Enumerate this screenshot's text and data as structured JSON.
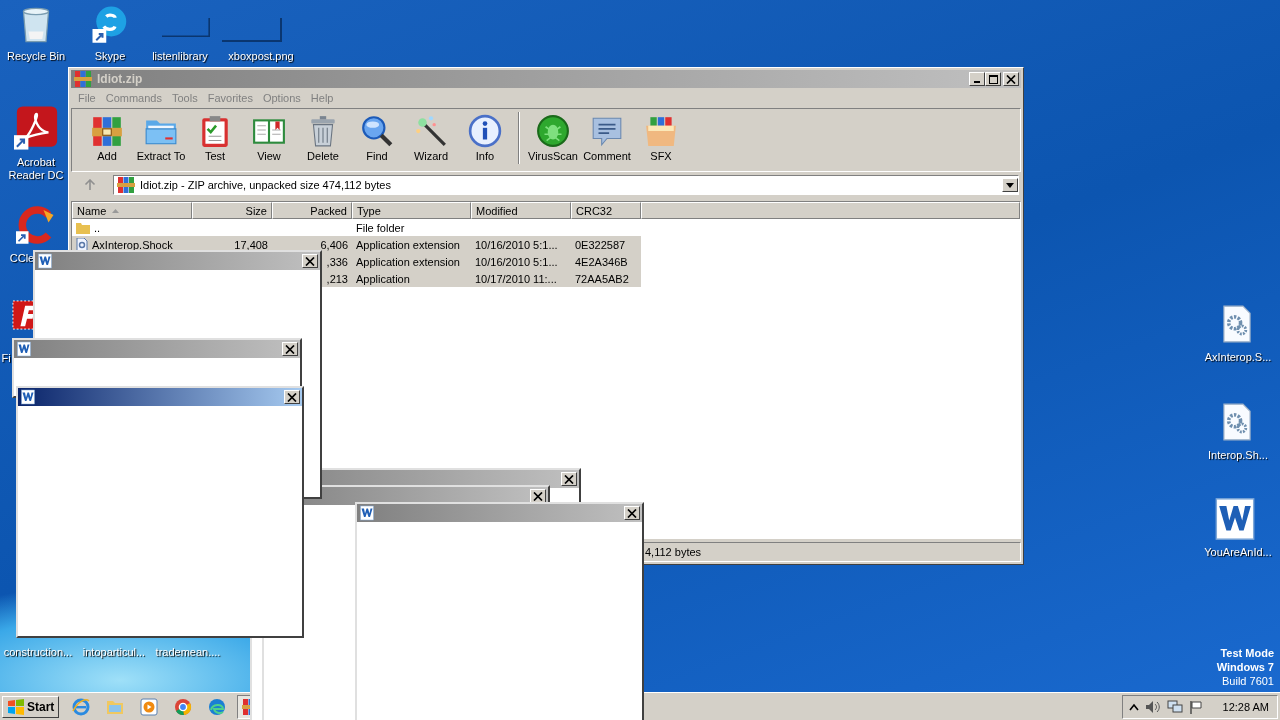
{
  "desktop_icons": [
    {
      "label": "Recycle Bin",
      "kind": "recycle"
    },
    {
      "label": "Skype",
      "kind": "skype"
    },
    {
      "label": "listenlibrary",
      "kind": "thumb"
    },
    {
      "label": "xboxpost.png",
      "kind": "thumb"
    },
    {
      "label": "Acrobat Reader DC",
      "kind": "acrobat"
    },
    {
      "label": "CCle",
      "kind": "ccleaner"
    },
    {
      "label": "Fi",
      "kind": "redapp"
    },
    {
      "label": "AxInterop.S...",
      "kind": "dll"
    },
    {
      "label": "Interop.Sh...",
      "kind": "dll"
    },
    {
      "label": "YouAreAnId...",
      "kind": "word"
    },
    {
      "label": "construction..."
    },
    {
      "label": "intoparticul..."
    },
    {
      "label": "trademean...."
    }
  ],
  "os_notice": {
    "mode": "Test Mode",
    "edition": "Windows 7",
    "build": "Build 7601"
  },
  "archive_window": {
    "title": "Idiot.zip",
    "menu": [
      "File",
      "Commands",
      "Tools",
      "Favorites",
      "Options",
      "Help"
    ],
    "toolbar": [
      {
        "label": "Add",
        "kind": "add"
      },
      {
        "label": "Extract To",
        "kind": "extract"
      },
      {
        "label": "Test",
        "kind": "test"
      },
      {
        "label": "View",
        "kind": "view"
      },
      {
        "label": "Delete",
        "kind": "delete"
      },
      {
        "label": "Find",
        "kind": "find"
      },
      {
        "label": "Wizard",
        "kind": "wizard"
      },
      {
        "label": "Info",
        "kind": "info"
      },
      {
        "label": "VirusScan",
        "kind": "virusscan"
      },
      {
        "label": "Comment",
        "kind": "comment"
      },
      {
        "label": "SFX",
        "kind": "sfx"
      }
    ],
    "address": "Idiot.zip - ZIP archive, unpacked size 474,112 bytes",
    "columns": [
      {
        "label": "Name",
        "sorted": true
      },
      {
        "label": "Size",
        "sorted": false
      },
      {
        "label": "Packed",
        "sorted": false
      },
      {
        "label": "Type",
        "sorted": false
      },
      {
        "label": "Modified",
        "sorted": false
      },
      {
        "label": "CRC32",
        "sorted": false
      }
    ],
    "rows": [
      {
        "kind": "folder",
        "name": "..",
        "type": "File folder",
        "selected": false
      },
      {
        "kind": "file",
        "name": "AxInterop.Shock",
        "size": "17,408",
        "packed": "6,406",
        "type": "Application extension",
        "modified": "10/16/2010 5:1...",
        "crc32": "0E322587",
        "selected": true
      },
      {
        "packed": ",336",
        "type": "Application extension",
        "modified": "10/16/2010 5:1...",
        "crc32": "4E2A346B",
        "selected": true
      },
      {
        "packed": ",213",
        "type": "Application",
        "modified": "10/17/2010 11:...",
        "crc32": "72AA5AB2",
        "selected": true
      }
    ],
    "status": "4,112 bytes"
  },
  "popups": [
    {
      "active": false
    },
    {
      "active": false
    },
    {
      "active": false
    },
    {
      "active": false
    },
    {
      "active": false
    },
    {
      "active": true
    }
  ],
  "taskbar": {
    "start": "Start",
    "apps": [
      {
        "kind": "ie",
        "selected": false
      },
      {
        "kind": "explorer",
        "selected": false
      },
      {
        "kind": "media",
        "selected": false
      },
      {
        "kind": "chrome",
        "selected": false
      },
      {
        "kind": "edge",
        "selected": false
      },
      {
        "kind": "winrar",
        "selected": true
      }
    ],
    "time": "12:28 AM"
  }
}
